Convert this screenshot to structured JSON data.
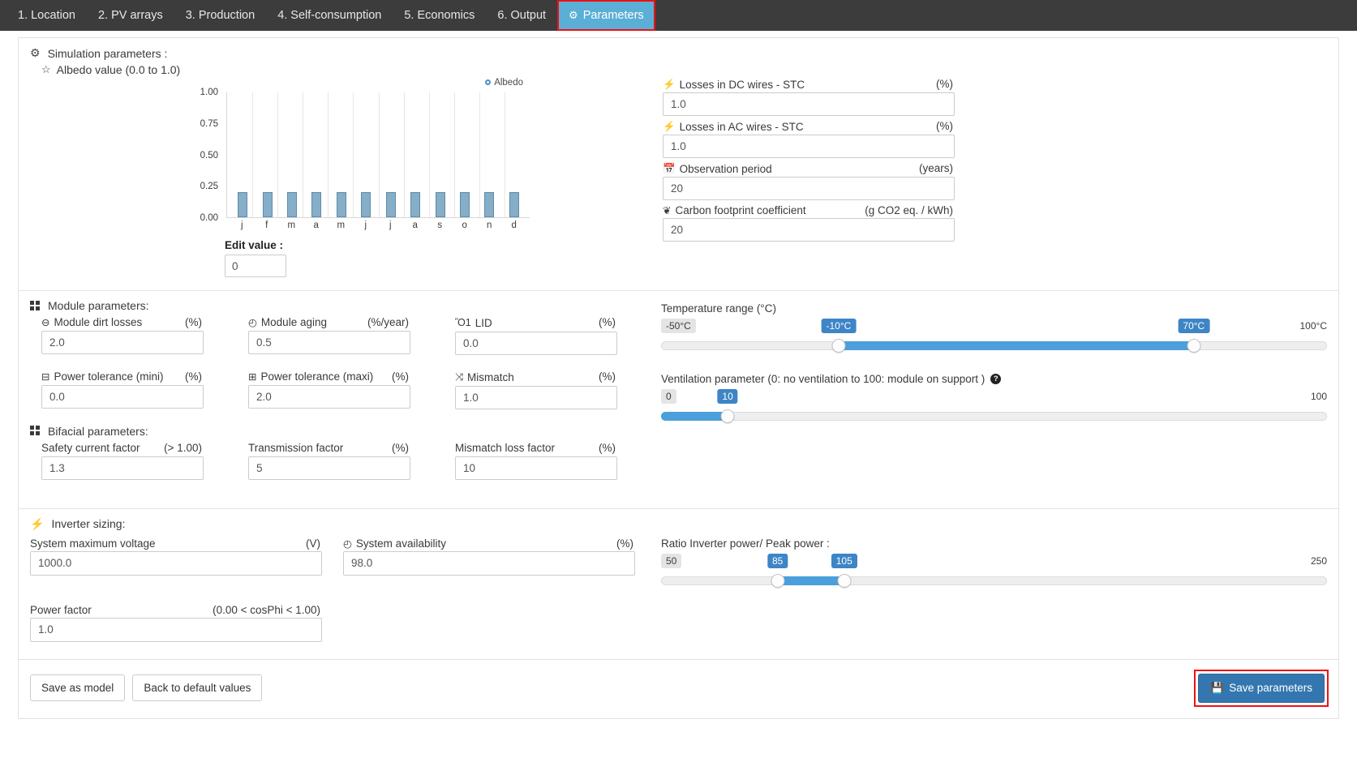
{
  "nav": {
    "items": [
      {
        "label": "1. Location",
        "active": false
      },
      {
        "label": "2. PV arrays",
        "active": false
      },
      {
        "label": "3. Production",
        "active": false
      },
      {
        "label": "4. Self-consumption",
        "active": false
      },
      {
        "label": "5. Economics",
        "active": false
      },
      {
        "label": "6. Output",
        "active": false
      },
      {
        "label": "Parameters",
        "active": true,
        "icon": "gears-icon"
      }
    ]
  },
  "simulation": {
    "title": "Simulation parameters :",
    "icon": "gears-icon",
    "albedo_label": "Albedo value (0.0 to 1.0)",
    "albedo_icon": "star-icon",
    "edit_value_label": "Edit value :",
    "edit_value": "0"
  },
  "chart_data": {
    "type": "bar",
    "title": "",
    "legend": [
      "Albedo"
    ],
    "legend_position": "top-right",
    "categories": [
      "j",
      "f",
      "m",
      "a",
      "m",
      "j",
      "j",
      "a",
      "s",
      "o",
      "n",
      "d"
    ],
    "values": [
      0.2,
      0.2,
      0.2,
      0.2,
      0.2,
      0.2,
      0.2,
      0.2,
      0.2,
      0.2,
      0.2,
      0.2
    ],
    "ylim": [
      0.0,
      1.0
    ],
    "yticks": [
      "0.00",
      "0.25",
      "0.50",
      "0.75",
      "1.00"
    ],
    "ytick_values": [
      0.0,
      0.25,
      0.5,
      0.75,
      1.0
    ],
    "xlabel": "",
    "ylabel": "",
    "grid": true,
    "bar_color": "#86aec8"
  },
  "losses_fields": [
    {
      "label": "Losses in DC wires - STC",
      "unit": "(%)",
      "value": "1.0",
      "icon": "bolt-icon",
      "name": "losses-dc-wires"
    },
    {
      "label": "Losses in AC wires - STC",
      "unit": "(%)",
      "value": "1.0",
      "icon": "bolt-icon",
      "name": "losses-ac-wires"
    },
    {
      "label": "Observation period",
      "unit": "(years)",
      "value": "20",
      "icon": "calendar-icon",
      "name": "observation-period"
    },
    {
      "label": "Carbon footprint coefficient",
      "unit": "(g CO2 eq. / kWh)",
      "value": "20",
      "icon": "leaf-icon",
      "name": "carbon-footprint-coefficient"
    }
  ],
  "module": {
    "title": "Module parameters:",
    "icon": "grid-icon",
    "row1": [
      {
        "label": "Module dirt losses",
        "unit": "(%)",
        "value": "2.0",
        "icon": "minus-circle-icon",
        "name": "module-dirt-losses"
      },
      {
        "label": "Module aging",
        "unit": "(%/year)",
        "value": "0.5",
        "icon": "clock-icon",
        "name": "module-aging"
      },
      {
        "label": "LID",
        "unit": "(%)",
        "value": "0.0",
        "icon": "lightbulb-icon",
        "name": "lid"
      }
    ],
    "row2": [
      {
        "label": "Power tolerance (mini)",
        "unit": "(%)",
        "value": "0.0",
        "icon": "minus-square-icon",
        "name": "power-tolerance-mini"
      },
      {
        "label": "Power tolerance (maxi)",
        "unit": "(%)",
        "value": "2.0",
        "icon": "plus-square-icon",
        "name": "power-tolerance-maxi"
      },
      {
        "label": "Mismatch",
        "unit": "(%)",
        "value": "1.0",
        "icon": "shuffle-icon",
        "name": "mismatch"
      }
    ]
  },
  "bifacial": {
    "title": "Bifacial parameters:",
    "icon": "grid-icon",
    "row": [
      {
        "label": "Safety current factor",
        "unit": "(> 1.00)",
        "value": "1.3",
        "icon": "",
        "name": "safety-current-factor"
      },
      {
        "label": "Transmission factor",
        "unit": "(%)",
        "value": "5",
        "icon": "",
        "name": "transmission-factor"
      },
      {
        "label": "Mismatch loss factor",
        "unit": "(%)",
        "value": "10",
        "icon": "",
        "name": "mismatch-loss-factor"
      }
    ]
  },
  "temperature_slider": {
    "title": "Temperature range (°C)",
    "min_label": "-50°C",
    "max_label": "100°C",
    "min": -50,
    "max": 100,
    "low_label": "-10°C",
    "high_label": "70°C",
    "low": -10,
    "high": 70
  },
  "ventilation_slider": {
    "title": "Ventilation parameter (0: no ventilation to 100: module on support )",
    "help_icon": "help-circle-icon",
    "min_label": "0",
    "max_label": "100",
    "min": 0,
    "max": 100,
    "value_label": "10",
    "value": 10
  },
  "inverter": {
    "title": "Inverter sizing:",
    "icon": "bolt-icon",
    "fields": [
      {
        "label": "System maximum voltage",
        "unit": "(V)",
        "value": "1000.0",
        "icon": "",
        "name": "system-maximum-voltage"
      },
      {
        "label": "System availability",
        "unit": "(%)",
        "value": "98.0",
        "icon": "clock-icon",
        "name": "system-availability"
      },
      {
        "label": "Power factor",
        "unit": "(0.00 < cosPhi < 1.00)",
        "value": "1.0",
        "icon": "",
        "name": "power-factor"
      }
    ]
  },
  "ratio_slider": {
    "title": "Ratio Inverter power/ Peak power :",
    "min_label": "50",
    "max_label": "250",
    "min": 50,
    "max": 250,
    "low_label": "85",
    "high_label": "105",
    "low": 85,
    "high": 105
  },
  "footer": {
    "save_as_model": "Save as model",
    "back_to_default": "Back to default values",
    "save_parameters": "Save parameters",
    "save_icon": "floppy-disk-icon"
  },
  "colors": {
    "accent": "#5bafd6",
    "slider_fill": "#4a9fdc",
    "badge_blue": "#3d85c6",
    "primary_button": "#3477b0",
    "highlight_outline": "#ee1111",
    "navbar": "#3c3c3c"
  }
}
